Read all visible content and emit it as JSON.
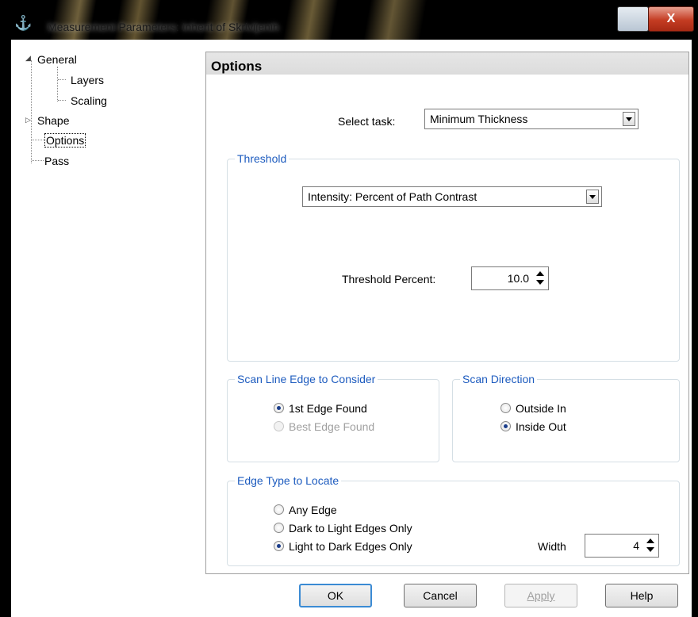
{
  "window": {
    "title": "Measurement Parameters: Inherit of Skrivljenih",
    "close_glyph": "X",
    "icons": [
      "app-icon",
      "minimize-maximize-icon",
      "close-icon"
    ]
  },
  "tree": {
    "items": [
      {
        "label": "General",
        "expanded": true
      },
      {
        "label": "Layers"
      },
      {
        "label": "Scaling"
      },
      {
        "label": "Shape",
        "expanded": false
      },
      {
        "label": "Options",
        "selected": true
      },
      {
        "label": "Pass"
      }
    ]
  },
  "options": {
    "header": "Options",
    "select_task_label": "Select task:",
    "select_task_value": "Minimum Thickness",
    "threshold": {
      "legend": "Threshold",
      "mode_value": "Intensity: Percent of Path Contrast",
      "percent_label": "Threshold Percent:",
      "percent_value": "10.0"
    },
    "scan_line_edge": {
      "legend": "Scan Line Edge to Consider",
      "options": [
        {
          "label": "1st Edge Found",
          "checked": true,
          "enabled": true
        },
        {
          "label": "Best Edge Found",
          "checked": false,
          "enabled": false
        }
      ]
    },
    "scan_direction": {
      "legend": "Scan Direction",
      "options": [
        {
          "label": "Outside In",
          "checked": false
        },
        {
          "label": "Inside Out",
          "checked": true
        }
      ]
    },
    "edge_type": {
      "legend": "Edge Type to Locate",
      "options": [
        {
          "label": "Any Edge",
          "checked": false
        },
        {
          "label": "Dark to Light Edges Only",
          "checked": false
        },
        {
          "label": "Light to Dark Edges Only",
          "checked": true
        }
      ],
      "width_label": "Width",
      "width_value": "4"
    }
  },
  "buttons": {
    "ok": "OK",
    "cancel": "Cancel",
    "apply": "Apply",
    "help": "Help"
  },
  "colors": {
    "group_legend": "#1e5cbf",
    "default_button_border": "#3b8bd4"
  }
}
